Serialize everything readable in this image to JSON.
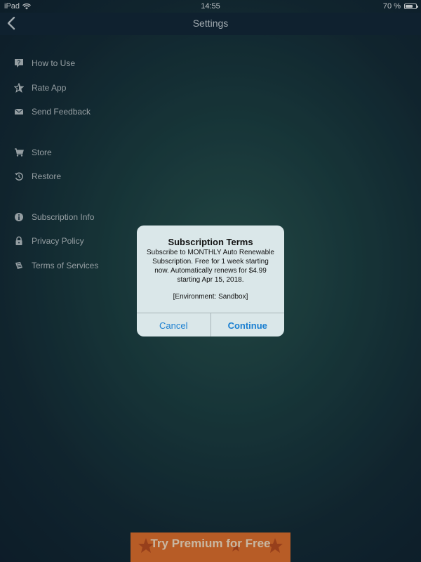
{
  "status_bar": {
    "device": "iPad",
    "time": "14:55",
    "battery_percent": "70 %",
    "battery_level": 0.7
  },
  "navbar": {
    "title": "Settings",
    "back_icon": "chevron-left-icon"
  },
  "menu": {
    "items": [
      {
        "label": "How to Use",
        "icon": "question-icon"
      },
      {
        "label": "Rate App",
        "icon": "star-icon"
      },
      {
        "label": "Send Feedback",
        "icon": "envelope-icon"
      },
      {
        "label": "Store",
        "icon": "cart-icon"
      },
      {
        "label": "Restore",
        "icon": "restore-icon"
      },
      {
        "label": "Subscription Info",
        "icon": "info-icon"
      },
      {
        "label": "Privacy Policy",
        "icon": "lock-icon"
      },
      {
        "label": "Terms of Services",
        "icon": "document-icon"
      }
    ]
  },
  "dialog": {
    "title": "Subscription Terms",
    "message": "Subscribe to MONTHLY Auto Renewable Subscription. Free for 1 week starting now. Automatically renews for $4.99 starting Apr 15, 2018.",
    "environment": "[Environment: Sandbox]",
    "cancel_label": "Cancel",
    "continue_label": "Continue",
    "button_color": "#1a7fd1"
  },
  "premium_banner": {
    "label": "Try Premium for Free",
    "color": "#e0712f"
  }
}
